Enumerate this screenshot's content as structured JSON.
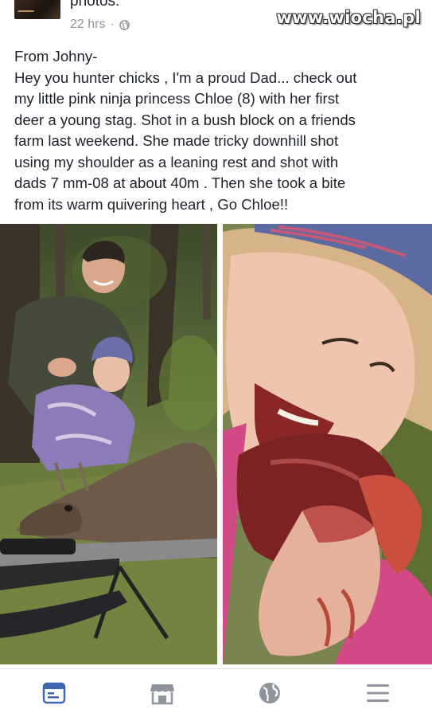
{
  "header": {
    "title_fragment": "photos.",
    "timestamp": "22 hrs",
    "separator": "·",
    "privacy_icon": "globe-icon",
    "watermark": "www.wiocha.pl"
  },
  "post": {
    "lines": [
      "From Johny-",
      "Hey you hunter chicks , I'm a proud Dad... check out",
      "my little pink ninja princess Chloe (8) with her first",
      "deer a young stag. Shot in a bush block on a friends",
      "farm last weekend. She made  tricky downhill shot",
      "using my shoulder as a leaning rest and shot with",
      "dads 7 mm-08 at about 40m . Then she took a bite",
      "from its warm quivering heart , Go Chloe!!"
    ]
  },
  "tabbar": {
    "tabs": [
      {
        "icon": "news-feed-icon",
        "active": true
      },
      {
        "icon": "marketplace-icon",
        "active": false
      },
      {
        "icon": "globe-icon",
        "active": false
      },
      {
        "icon": "menu-icon",
        "active": false
      }
    ],
    "active_color": "#4267b2",
    "inactive_color": "#90949c"
  }
}
